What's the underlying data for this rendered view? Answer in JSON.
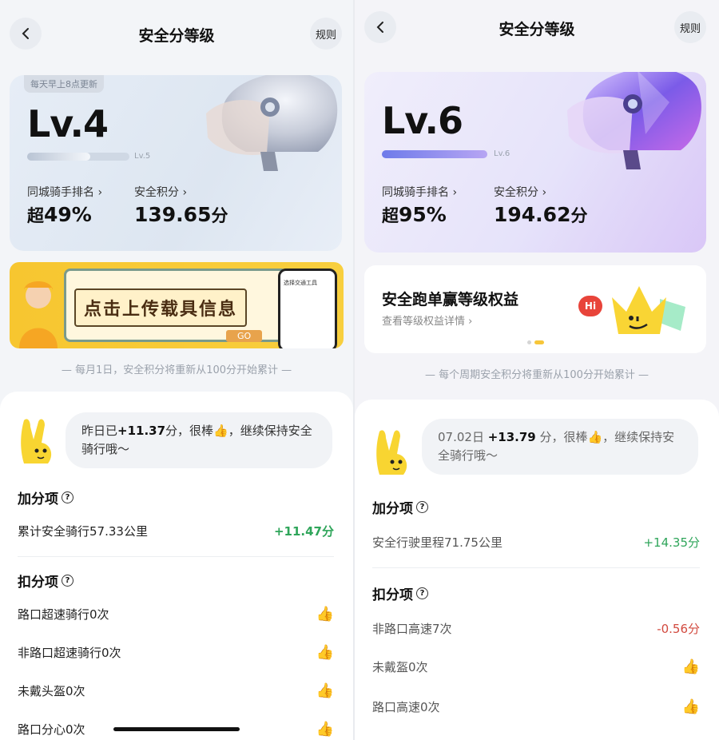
{
  "left": {
    "header": {
      "title": "安全分等级",
      "rules": "规则"
    },
    "card": {
      "update_tag": "每天早上8点更新",
      "level": "Lv.4",
      "next_level": "Lv.5",
      "progress_fraction": 0.62,
      "rank_label": "同城骑手排名 ›",
      "rank_prefix": "超",
      "rank_value": "49%",
      "score_label": "安全积分 ›",
      "score_value": "139.65",
      "score_suffix": "分"
    },
    "banner": {
      "text": "点击上传载具信息",
      "go": "GO",
      "phone_header": "选择交通工具"
    },
    "reset_note": "— 每月1日，安全积分将重新从100分开始累计 —",
    "message": {
      "prefix": "昨日已",
      "delta": "+11.37",
      "suffix": "分，很棒👍，继续保持安全骑行哦～"
    },
    "bonus": {
      "title": "加分项",
      "items": [
        {
          "label": "累计安全骑行57.33公里",
          "value": "+11.47分"
        }
      ]
    },
    "deduct": {
      "title": "扣分项",
      "items": [
        {
          "label": "路口超速骑行0次"
        },
        {
          "label": "非路口超速骑行0次"
        },
        {
          "label": "未戴头盔0次"
        },
        {
          "label": "路口分心0次"
        }
      ]
    }
  },
  "right": {
    "header": {
      "title": "安全分等级",
      "rules": "规则"
    },
    "card": {
      "level": "Lv.6",
      "next_level": "Lv.6",
      "progress_fraction": 1.0,
      "rank_label": "同城骑手排名 ›",
      "rank_prefix": "超",
      "rank_value": "95%",
      "score_label": "安全积分 ›",
      "score_value": "194.62",
      "score_suffix": "分"
    },
    "benefit": {
      "title": "安全跑单赢等级权益",
      "sub": "查看等级权益详情 ›",
      "hi": "Hi"
    },
    "reset_note": "— 每个周期安全积分将重新从100分开始累计 —",
    "message": {
      "prefix": "07.02日 ",
      "delta": "+13.79",
      "suffix": " 分，很棒👍，继续保持安全骑行哦～"
    },
    "bonus": {
      "title": "加分项",
      "items": [
        {
          "label": "安全行驶里程71.75公里",
          "value": "+14.35分"
        }
      ]
    },
    "deduct": {
      "title": "扣分项",
      "items": [
        {
          "label": "非路口高速7次",
          "value": "-0.56分"
        },
        {
          "label": "未戴盔0次"
        },
        {
          "label": "路口高速0次"
        }
      ]
    }
  },
  "colors": {
    "positive": "#2fa55a",
    "negative": "#d24a3f",
    "accent_yellow": "#f7c63a"
  },
  "icons": [
    "chevron-left-icon",
    "help-circle-icon",
    "thumbs-up-icon",
    "helmet-icon",
    "mascot-icon",
    "crown-icon"
  ]
}
